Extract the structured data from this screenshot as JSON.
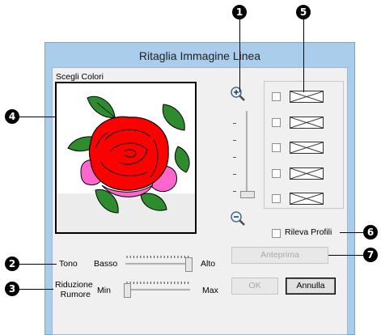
{
  "window": {
    "title": "Ritaglia Immagine Linea"
  },
  "image_group": {
    "label": "Scegli Colori"
  },
  "profiles": {
    "rows": 5
  },
  "detect": {
    "label": "Rileva Profili",
    "checked": false
  },
  "tone": {
    "label": "Tono",
    "min_label": "Basso",
    "max_label": "Alto",
    "level_percent": 100
  },
  "noise": {
    "label_line1": "Riduzione",
    "label_line2": "Rumore",
    "min_label": "Min",
    "max_label": "Max",
    "level_percent": 0
  },
  "buttons": {
    "preview": "Anteprima",
    "ok": "OK",
    "cancel": "Annulla"
  },
  "callouts": {
    "c1": "1",
    "c2": "2",
    "c3": "3",
    "c4": "4",
    "c5": "5",
    "c6": "6",
    "c7": "7"
  },
  "colors": {
    "titlebar": "#a9cdeb",
    "rose_red": "#ff0000",
    "rose_pink": "#ff66cc",
    "leaf_green": "#2e8b2e"
  }
}
